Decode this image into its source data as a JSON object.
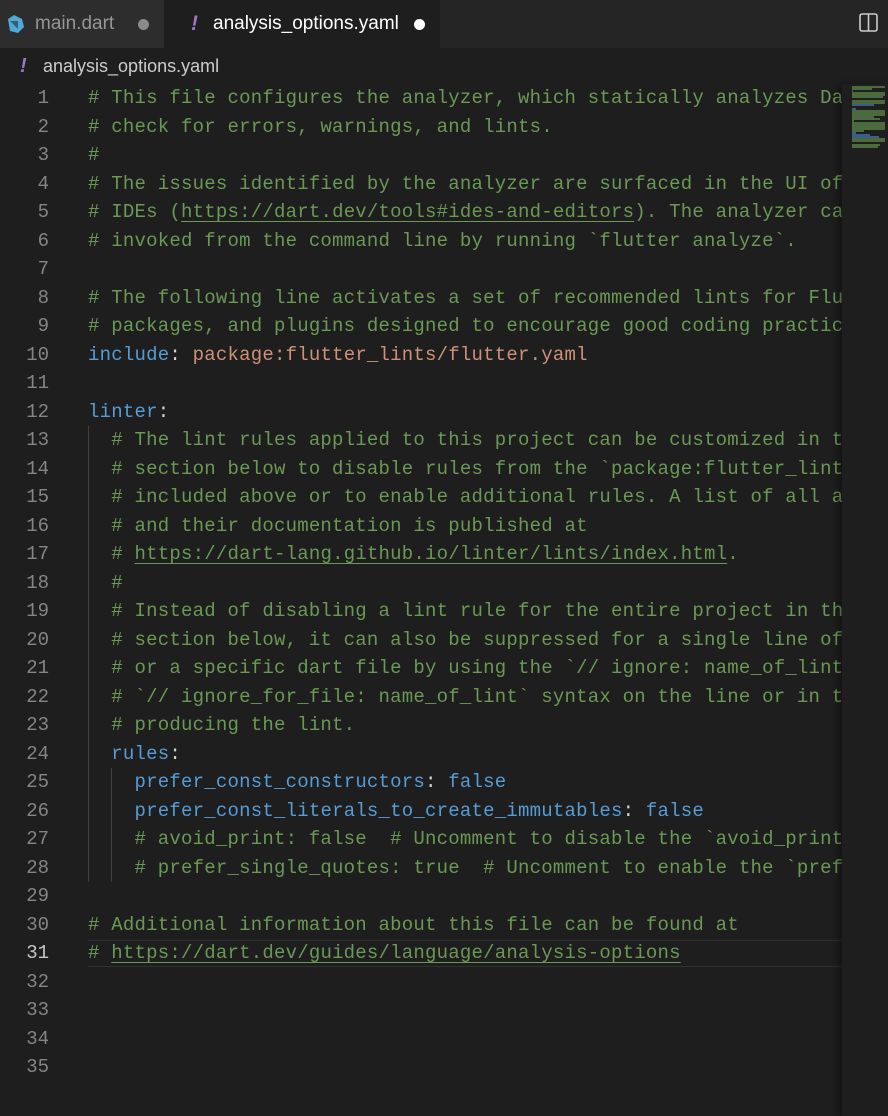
{
  "tabs": [
    {
      "label": "main.dart",
      "icon": "dart-icon",
      "dirty": true
    },
    {
      "label": "analysis_options.yaml",
      "icon": "yaml-icon",
      "dirty": true,
      "active": true
    }
  ],
  "tab_icons": {
    "yaml_glyph": "!"
  },
  "breadcrumb": {
    "file": "analysis_options.yaml",
    "icon": "yaml-icon"
  },
  "colors": {
    "comment": "#6a9955",
    "key": "#569cd6",
    "string": "#ce9178",
    "punctuation": "#d4d4d4",
    "editor_bg": "#1e1e1e",
    "yaml_icon": "#a074c4"
  },
  "editor": {
    "active_line": 31,
    "line_numbers": [
      "1",
      "2",
      "3",
      "4",
      "5",
      "6",
      "7",
      "8",
      "9",
      "10",
      "11",
      "12",
      "13",
      "14",
      "15",
      "16",
      "17",
      "18",
      "19",
      "20",
      "21",
      "22",
      "23",
      "24",
      "25",
      "26",
      "27",
      "28",
      "29",
      "30",
      "31",
      "32",
      "33",
      "34",
      "35"
    ],
    "lines": [
      {
        "t": "# This file configures the analyzer, which statically analyzes Dar"
      },
      {
        "t": "# check for errors, warnings, and lints."
      },
      {
        "t": "#"
      },
      {
        "t": "# The issues identified by the analyzer are surfaced in the UI of"
      },
      {
        "p1": "# IDEs (",
        "url": "https://dart.dev/tools#ides-and-editors",
        "p2": "). The analyzer can"
      },
      {
        "t": "# invoked from the command line by running `flutter analyze`."
      },
      {
        "t": ""
      },
      {
        "t": "# The following line activates a set of recommended lints for Flut"
      },
      {
        "t": "# packages, and plugins designed to encourage good coding practice"
      },
      {
        "key": "include",
        "colon": ": ",
        "value": "package:flutter_lints/flutter.yaml"
      },
      {
        "t": ""
      },
      {
        "key": "linter",
        "colon": ":"
      },
      {
        "t": "  # The lint rules applied to this project can be customized in th"
      },
      {
        "t": "  # section below to disable rules from the `package:flutter_lints"
      },
      {
        "t": "  # included above or to enable additional rules. A list of all av"
      },
      {
        "t": "  # and their documentation is published at"
      },
      {
        "p1": "  # ",
        "url": "https://dart-lang.github.io/linter/lints/index.html",
        "p2": "."
      },
      {
        "t": "  #"
      },
      {
        "t": "  # Instead of disabling a lint rule for the entire project in the"
      },
      {
        "t": "  # section below, it can also be suppressed for a single line of"
      },
      {
        "t": "  # or a specific dart file by using the `// ignore: name_of_lint`"
      },
      {
        "t": "  # `// ignore_for_file: name_of_lint` syntax on the line or in th"
      },
      {
        "t": "  # producing the lint."
      },
      {
        "indent": "  ",
        "key": "rules",
        "colon": ":"
      },
      {
        "indent": "    ",
        "key": "prefer_const_constructors",
        "colon": ": ",
        "kval": "false"
      },
      {
        "indent": "    ",
        "key": "prefer_const_literals_to_create_immutables",
        "colon": ": ",
        "kval": "false"
      },
      {
        "t": "    # avoid_print: false  # Uncomment to disable the `avoid_print`"
      },
      {
        "t": "    # prefer_single_quotes: true  # Uncomment to enable the `prefe"
      },
      {
        "t": ""
      },
      {
        "t": "# Additional information about this file can be found at"
      },
      {
        "p1": "# ",
        "url": "https://dart.dev/guides/language/analysis-options",
        "p2": ""
      },
      {
        "t": ""
      },
      {
        "t": ""
      },
      {
        "t": ""
      },
      {
        "t": ""
      }
    ]
  }
}
